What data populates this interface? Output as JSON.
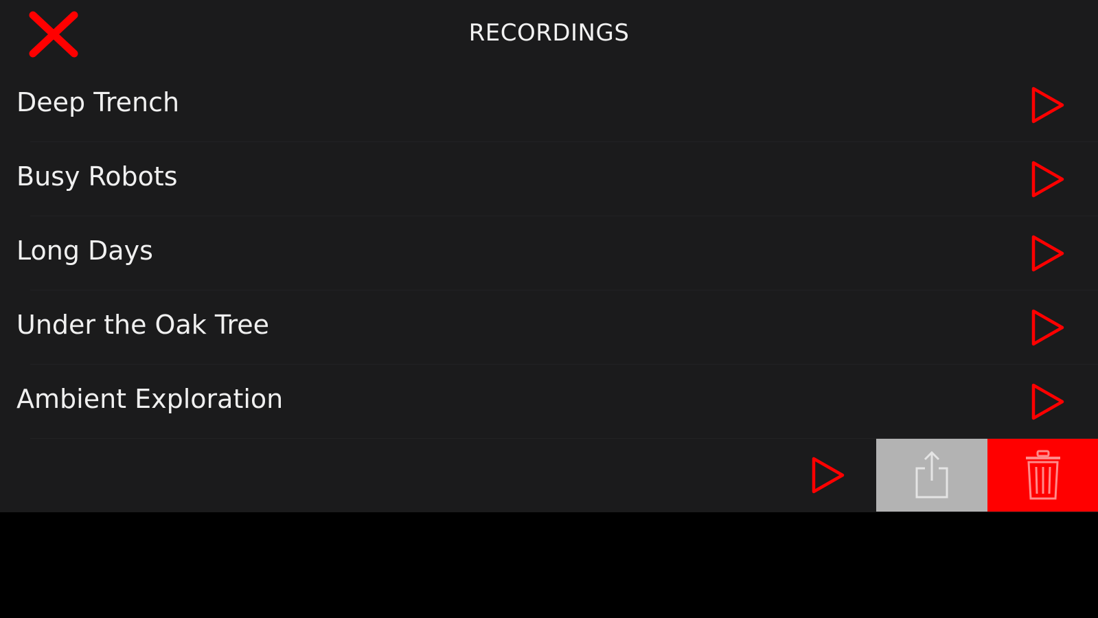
{
  "header": {
    "title": "RECORDINGS",
    "close_icon": "close-icon"
  },
  "recordings": [
    {
      "label": "Deep Trench",
      "icon": "play-icon"
    },
    {
      "label": "Busy Robots",
      "icon": "play-icon"
    },
    {
      "label": "Long Days",
      "icon": "play-icon"
    },
    {
      "label": "Under the Oak Tree",
      "icon": "play-icon"
    },
    {
      "label": "Ambient Exploration",
      "icon": "play-icon"
    }
  ],
  "swiped_row": {
    "label": "",
    "actions": [
      {
        "name": "share",
        "icon": "share-icon"
      },
      {
        "name": "delete",
        "icon": "trash-icon"
      }
    ]
  },
  "colors": {
    "accent": "#ff0000",
    "panel_background": "#1b1b1c",
    "page_background": "#000000",
    "share_action_background": "#b3b3b3",
    "text": "#f0f0f0"
  }
}
